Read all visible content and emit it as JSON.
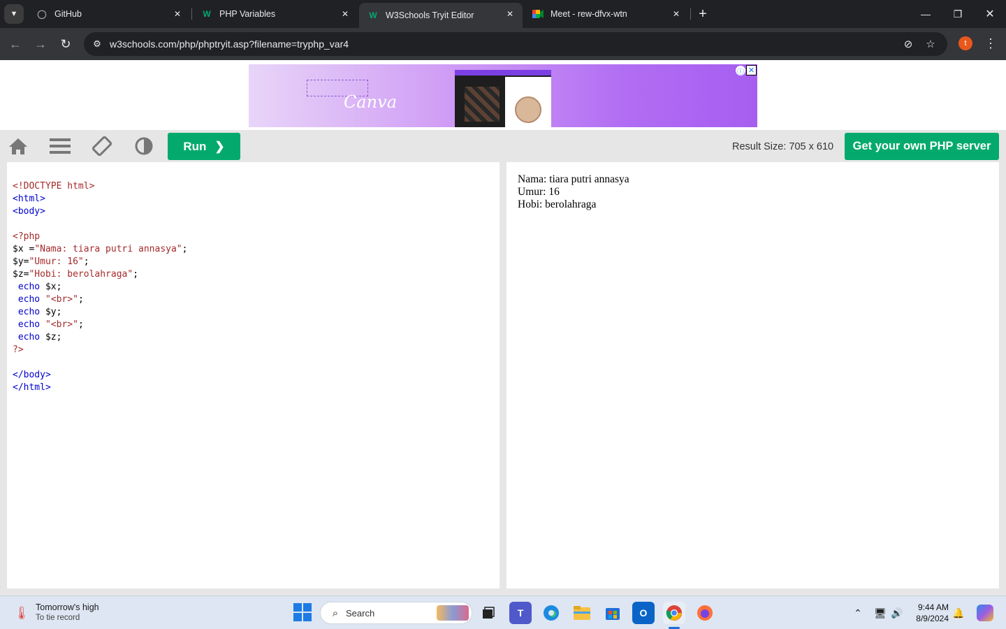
{
  "browser": {
    "tabs": [
      {
        "title": "GitHub",
        "icon": "github-icon"
      },
      {
        "title": "PHP Variables",
        "icon": "w3schools-icon"
      },
      {
        "title": "W3Schools Tryit Editor",
        "icon": "w3schools-icon",
        "active": true
      },
      {
        "title": "Meet - rew-dfvx-wtn",
        "icon": "google-meet-icon"
      }
    ],
    "url": "w3schools.com/php/phptryit.asp?filename=tryphp_var4",
    "profile_initial": "t"
  },
  "ad": {
    "brand": "Canva"
  },
  "tryit": {
    "run_label": "Run",
    "result_size": "Result Size: 705 x 610",
    "server_button": "Get your own PHP server"
  },
  "editor": {
    "lines": [
      "<!DOCTYPE html>",
      "<html>",
      "<body>",
      "",
      "<?php",
      "$x =\"Nama: tiara putri annasya\";",
      "$y=\"Umur: 16\";",
      "$z=\"Hobi: berolahraga\";",
      " echo $x;",
      " echo \"<br>\";",
      " echo $y;",
      " echo \"<br>\";",
      " echo $z;",
      "?>",
      "",
      "</body>",
      "</html>"
    ]
  },
  "result": {
    "lines": [
      "Nama: tiara putri annasya",
      "Umur: 16",
      "Hobi: berolahraga"
    ]
  },
  "taskbar": {
    "weather_title": "Tomorrow's high",
    "weather_sub": "To tie record",
    "search_label": "Search",
    "time": "9:44 AM",
    "date": "8/9/2024"
  },
  "colors": {
    "accent_green": "#04aa6d",
    "chrome_dark": "#202124",
    "chrome_toolbar": "#35363a"
  }
}
